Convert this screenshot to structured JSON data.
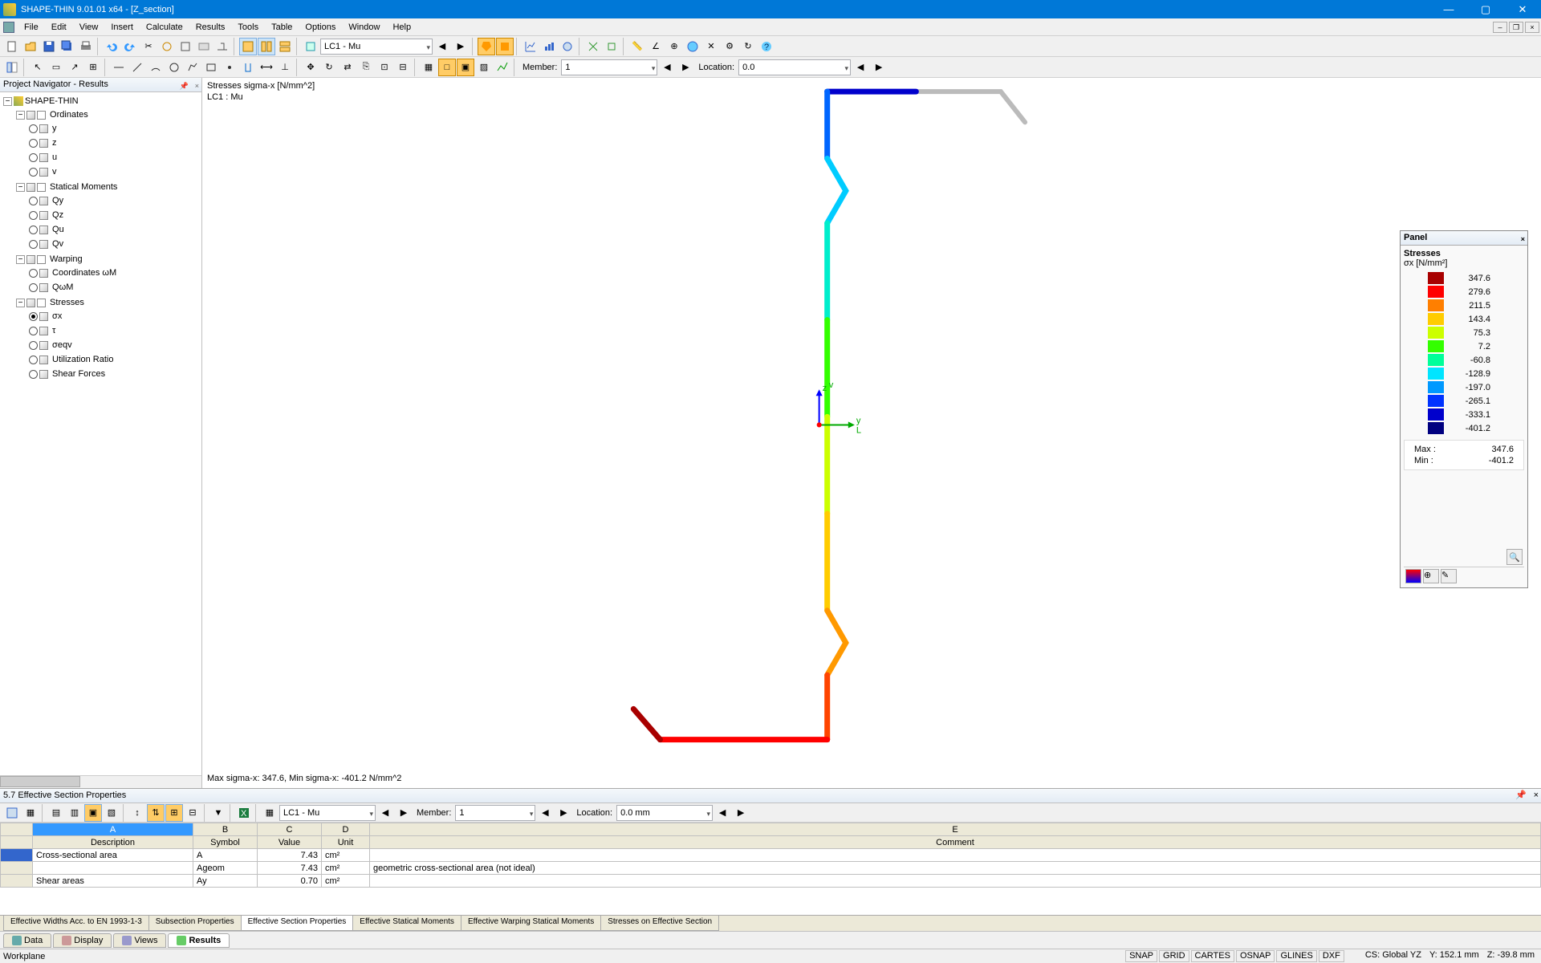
{
  "title": "SHAPE-THIN 9.01.01 x64 - [Z_section]",
  "menu": [
    "File",
    "Edit",
    "View",
    "Insert",
    "Calculate",
    "Results",
    "Tools",
    "Table",
    "Options",
    "Window",
    "Help"
  ],
  "toolbar1": {
    "combo1": "LC1 - Mu"
  },
  "toolbar2": {
    "member_label": "Member:",
    "member_val": "1",
    "location_label": "Location:",
    "location_val": "0.0"
  },
  "navigator": {
    "title": "Project Navigator - Results",
    "root": "SHAPE-THIN",
    "groups": [
      {
        "name": "Ordinates",
        "items": [
          "y",
          "z",
          "u",
          "v"
        ]
      },
      {
        "name": "Statical Moments",
        "items": [
          "Qy",
          "Qz",
          "Qu",
          "Qv"
        ]
      },
      {
        "name": "Warping",
        "items": [
          "Coordinates ωM",
          "QωM"
        ]
      },
      {
        "name": "Stresses",
        "items": [
          "σx",
          "τ",
          "σeqv",
          "Utilization Ratio",
          "Shear Forces"
        ],
        "selected": "σx"
      }
    ]
  },
  "viewport": {
    "title": "Stresses sigma-x [N/mm^2]",
    "subtitle": "LC1 : Mu",
    "footer": "Max sigma-x: 347.6, Min sigma-x: -401.2 N/mm^2",
    "axis_y": "y",
    "axis_z": "z",
    "axis_v": "v",
    "axis_L": "L"
  },
  "panel": {
    "title": "Panel",
    "heading": "Stresses",
    "unit": "σx [N/mm²]",
    "scale": [
      {
        "c": "#a80000",
        "v": "347.6"
      },
      {
        "c": "#ff0000",
        "v": "279.6"
      },
      {
        "c": "#ff7f00",
        "v": "211.5"
      },
      {
        "c": "#ffcc00",
        "v": "143.4"
      },
      {
        "c": "#ccff00",
        "v": "75.3"
      },
      {
        "c": "#33ff00",
        "v": "7.2"
      },
      {
        "c": "#00ff99",
        "v": "-60.8"
      },
      {
        "c": "#00e5ff",
        "v": "-128.9"
      },
      {
        "c": "#0099ff",
        "v": "-197.0"
      },
      {
        "c": "#0033ff",
        "v": "-265.1"
      },
      {
        "c": "#0000cc",
        "v": "-333.1"
      },
      {
        "c": "#000080",
        "v": "-401.2"
      }
    ],
    "max_label": "Max  :",
    "max": "347.6",
    "min_label": "Min  :",
    "min": "-401.2"
  },
  "table": {
    "title": "5.7 Effective Section Properties",
    "combo": "LC1 - Mu",
    "member_label": "Member:",
    "member_val": "1",
    "location_label": "Location:",
    "location_val": "0.0 mm",
    "cols": [
      "A",
      "B",
      "C",
      "D",
      "E"
    ],
    "headers": [
      "Description",
      "Symbol",
      "Value",
      "Unit",
      "Comment"
    ],
    "rows": [
      {
        "desc": "Cross-sectional area",
        "sym": "A",
        "val": "7.43",
        "unit": "cm²",
        "comment": ""
      },
      {
        "desc": "",
        "sym": "Ageom",
        "val": "7.43",
        "unit": "cm²",
        "comment": "geometric cross-sectional area (not ideal)"
      },
      {
        "desc": "Shear areas",
        "sym": "Ay",
        "val": "0.70",
        "unit": "cm²",
        "comment": ""
      }
    ],
    "tabs": [
      "Effective Widths Acc. to EN 1993-1-3",
      "Subsection Properties",
      "Effective Section Properties",
      "Effective Statical Moments",
      "Effective Warping Statical Moments",
      "Stresses on Effective Section"
    ],
    "active_tab": "Effective Section Properties"
  },
  "viewtabs": [
    {
      "label": "Data",
      "icon": "#6aa"
    },
    {
      "label": "Display",
      "icon": "#c99"
    },
    {
      "label": "Views",
      "icon": "#99c"
    },
    {
      "label": "Results",
      "icon": "#6c6",
      "active": true
    }
  ],
  "status": {
    "left": "Workplane",
    "snap": "SNAP",
    "grid": "GRID",
    "cartes": "CARTES",
    "osnap": "OSNAP",
    "glines": "GLINES",
    "dxf": "DXF",
    "cs": "CS: Global YZ",
    "y": "Y:  152.1 mm",
    "z": "Z:  -39.8 mm"
  }
}
